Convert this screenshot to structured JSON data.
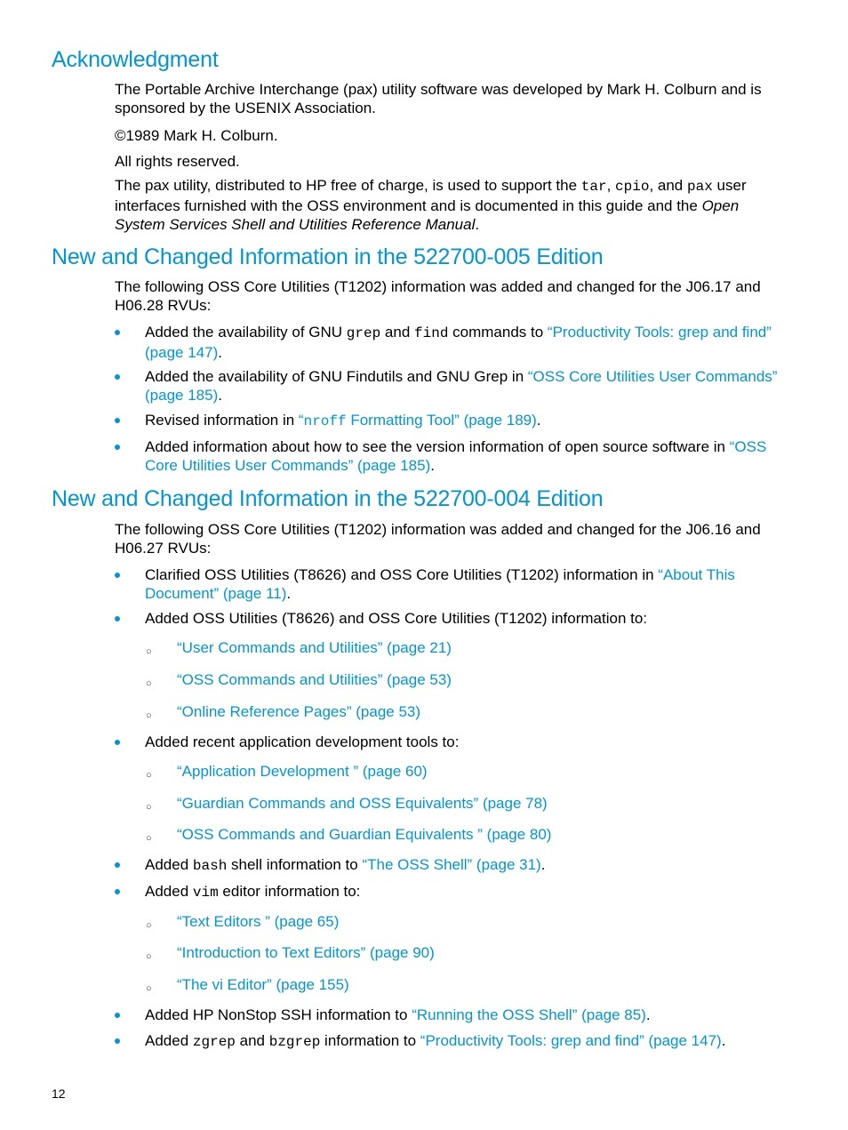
{
  "sections": {
    "ack": {
      "title": "Acknowledgment",
      "p1": "The Portable Archive Interchange (pax) utility software was developed by Mark H. Colburn and is sponsored by the USENIX Association.",
      "p2": "©1989 Mark H. Colburn.",
      "p3": "All rights reserved.",
      "p4_a": "The pax utility, distributed to HP free of charge, is used to support the ",
      "p4_tar": "tar",
      "p4_b": ", ",
      "p4_cpio": "cpio",
      "p4_c": ", and ",
      "p4_pax": "pax",
      "p4_d": " user interfaces furnished with the OSS environment and is documented in this guide and the ",
      "p4_italic": "Open System Services Shell and Utilities Reference Manual",
      "p4_e": "."
    },
    "ed005": {
      "title": "New and Changed Information in the 522700-005 Edition",
      "intro": "The following OSS Core Utilities (T1202) information was added and changed for the J06.17 and H06.28 RVUs:",
      "b1_a": "Added the availability of GNU ",
      "b1_grep": "grep",
      "b1_b": " and ",
      "b1_find": "find",
      "b1_c": " commands to ",
      "b1_link": "“Productivity Tools: grep and find” (page 147)",
      "b2_a": "Added the availability of GNU Findutils and GNU Grep in ",
      "b2_link": "“OSS Core Utilities User Commands” (page 185)",
      "b3_a": "Revised information in ",
      "b3_link_q": "“",
      "b3_link_mono": "nroff",
      "b3_link_rest": " Formatting Tool” (page 189)",
      "b4_a": "Added information about how to see the version information of open source software in ",
      "b4_link": "“OSS Core Utilities User Commands” (page 185)",
      "period": "."
    },
    "ed004": {
      "title": "New and Changed Information in the 522700-004 Edition",
      "intro": "The following OSS Core Utilities (T1202) information was added and changed for the J06.16 and H06.27 RVUs:",
      "b1_a": "Clarified OSS Utilities (T8626) and OSS Core Utilities (T1202) information in ",
      "b1_link": "“About This Document” (page 11)",
      "b2": "Added OSS Utilities (T8626) and OSS Core Utilities (T1202) information to:",
      "b2_subs": [
        "“User Commands and Utilities” (page 21)",
        "“OSS Commands and Utilities” (page 53)",
        "“Online Reference Pages” (page 53)"
      ],
      "b3": "Added recent application development tools to:",
      "b3_subs": [
        "“Application Development ” (page 60)",
        "“Guardian Commands and OSS Equivalents” (page 78)",
        "“OSS Commands and Guardian Equivalents ” (page 80)"
      ],
      "b4_a": "Added ",
      "b4_bash": "bash",
      "b4_b": " shell information to ",
      "b4_link": "“The OSS Shell” (page 31)",
      "b5_a": "Added ",
      "b5_vim": "vim",
      "b5_b": " editor information to:",
      "b5_subs": [
        "“Text Editors ” (page 65)",
        "“Introduction to Text Editors” (page 90)",
        "“The vi Editor” (page 155)"
      ],
      "b6_a": "Added HP NonStop SSH information to ",
      "b6_link": "“Running the OSS Shell” (page 85)",
      "b7_a": "Added ",
      "b7_zgrep": "zgrep",
      "b7_b": " and ",
      "b7_bzgrep": "bzgrep",
      "b7_c": " information to ",
      "b7_link": "“Productivity Tools: grep and find” (page 147)",
      "period": "."
    }
  },
  "page_number": "12",
  "colors": {
    "accent": "#0096d6",
    "text": "#000000"
  }
}
